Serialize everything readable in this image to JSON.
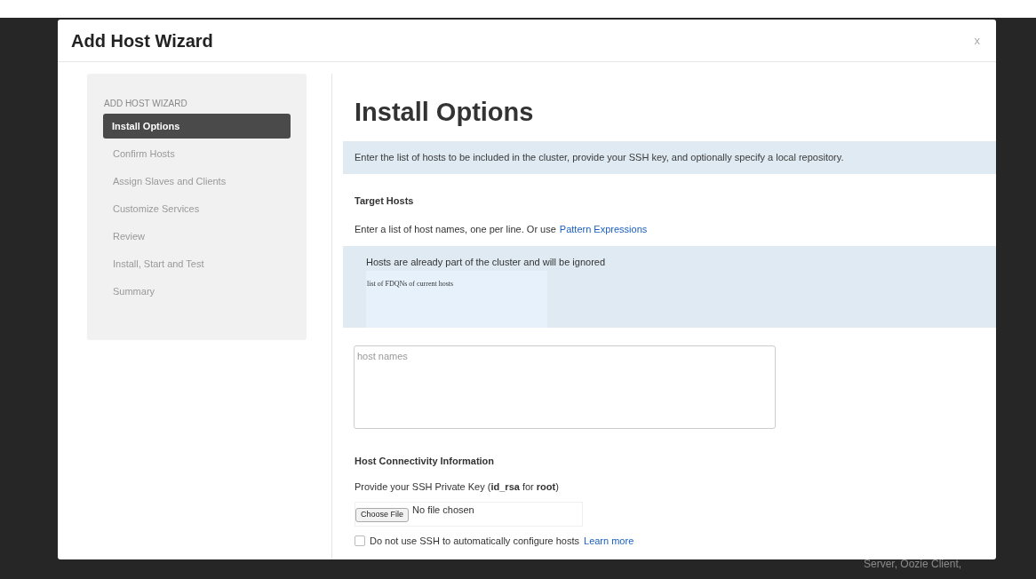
{
  "window": {
    "title": "Add Host Wizard",
    "close": "x"
  },
  "sidebar": {
    "heading": "ADD HOST WIZARD",
    "items": [
      {
        "label": "Install Options",
        "selected": true
      },
      {
        "label": "Confirm Hosts",
        "selected": false
      },
      {
        "label": "Assign Slaves and Clients",
        "selected": false
      },
      {
        "label": "Customize Services",
        "selected": false
      },
      {
        "label": "Review",
        "selected": false
      },
      {
        "label": "Install, Start and Test",
        "selected": false
      },
      {
        "label": "Summary",
        "selected": false
      }
    ]
  },
  "content": {
    "title": "Install Options",
    "intro": "Enter the list of hosts to be included in the cluster, provide your SSH key, and optionally specify a local repository.",
    "target_hosts": {
      "heading": "Target Hosts",
      "instructions": "Enter a list of host names, one per line. Or use",
      "link": "Pattern Expressions",
      "notice": {
        "message": "Hosts are already part of the cluster and will be ignored",
        "list_label": "list of FDQNs of current hosts"
      },
      "hosts_field": {
        "placeholder": "host names"
      }
    },
    "connectivity": {
      "heading": "Host Connectivity Information",
      "key_prompt": "Provide your SSH Private Key (**id_rsa** for **root**)",
      "file_button": "Choose File",
      "file_status": "No file chosen",
      "manual_option": {
        "label": "Do not use SSH to automatically configure hosts",
        "checked": false,
        "link": "Learn more"
      }
    }
  },
  "background": {
    "text": "Server, Oozie Client,"
  }
}
